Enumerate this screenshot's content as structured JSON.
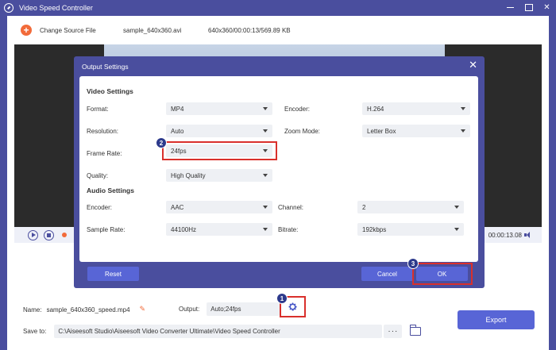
{
  "window": {
    "title": "Video Speed Controller"
  },
  "topbar": {
    "change_source_label": "Change Source File",
    "file_name": "sample_640x360.avi",
    "file_info": "640x360/00:00:13/569.89 KB"
  },
  "player": {
    "time": "00:00:13.08"
  },
  "dialog": {
    "title": "Output Settings",
    "video_section": "Video Settings",
    "audio_section": "Audio Settings",
    "format": {
      "label": "Format:",
      "value": "MP4"
    },
    "encoder": {
      "label": "Encoder:",
      "value": "H.264"
    },
    "resolution": {
      "label": "Resolution:",
      "value": "Auto"
    },
    "zoom_mode": {
      "label": "Zoom Mode:",
      "value": "Letter Box"
    },
    "frame_rate": {
      "label": "Frame Rate:",
      "value": "24fps"
    },
    "quality": {
      "label": "Quality:",
      "value": "High Quality"
    },
    "audio_encoder": {
      "label": "Encoder:",
      "value": "AAC"
    },
    "channel": {
      "label": "Channel:",
      "value": "2"
    },
    "sample_rate": {
      "label": "Sample Rate:",
      "value": "44100Hz"
    },
    "bitrate": {
      "label": "Bitrate:",
      "value": "192kbps"
    },
    "reset_label": "Reset",
    "cancel_label": "Cancel",
    "ok_label": "OK"
  },
  "badges": {
    "one": "1",
    "two": "2",
    "three": "3"
  },
  "bottom": {
    "name_label": "Name:",
    "name_value": "sample_640x360_speed.mp4",
    "output_label": "Output:",
    "output_value": "Auto;24fps",
    "save_to_label": "Save to:",
    "save_path": "C:\\Aiseesoft Studio\\Aiseesoft Video Converter Ultimate\\Video Speed Controller",
    "more_label": "···",
    "export_label": "Export"
  },
  "colors": {
    "chrome": "#4a4e9e",
    "accent": "#5865d6",
    "orange": "#f26b3a",
    "highlight": "#d9302c",
    "badge": "#2d3a8c"
  }
}
